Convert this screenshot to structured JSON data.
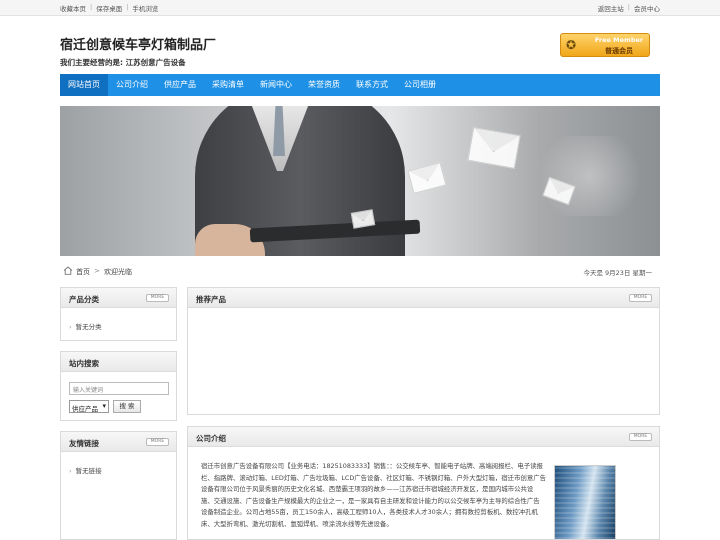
{
  "topbar": {
    "left": [
      "收藏本页",
      "保存桌面",
      "手机浏览"
    ],
    "right": [
      "返回主站",
      "会员中心"
    ],
    "sep": "|"
  },
  "header": {
    "title": "宿迁创意候车亭灯箱制品厂",
    "subtitle": "我们主要经营的是: 江苏创意广告设备"
  },
  "member_badge": {
    "line1": "Free Member",
    "line2": "普通会员"
  },
  "nav": [
    "网站首页",
    "公司介绍",
    "供应产品",
    "采购清单",
    "新闻中心",
    "荣誉资质",
    "联系方式",
    "公司相册"
  ],
  "breadcrumb": {
    "home": "首页",
    "arrow": ">",
    "current": "欢迎光临",
    "date": "今天是  9月23日 星期一"
  },
  "more_label": "MORE",
  "sidebar": {
    "categories": {
      "title": "产品分类",
      "items": [
        "暂无分类"
      ]
    },
    "search": {
      "title": "站内搜索",
      "placeholder": "输入关键词",
      "select_value": "供应产品",
      "button": "搜 索"
    },
    "links": {
      "title": "友情链接",
      "items": [
        "暂无链接"
      ]
    }
  },
  "recommend": {
    "title": "推荐产品"
  },
  "intro": {
    "title": "公司介绍",
    "text": "宿迁市创意广告设备有限公司【业务电话：18251083333】销售：：公交候车亭、智能电子站牌、高端阅报栏、电子读报栏、指路牌、滚动灯箱、LED灯箱、广告垃圾箱、LCD广告设备、社区灯箱、不锈钢灯箱、户外大型灯箱，宿迁市创意广告设备有限公司位于风景秀丽的历史文化名城、西楚霸王项羽的故乡——江苏宿迁市宿城经济开发区，是国内城市公共设施、交通设施、广告设备生产规模最大的企业之一，是一家具有自主研发和设计能力的以公交候车亭为主导的综合性广告设备制造企业。公司占地55亩，员工150余人，高级工程师10人，各类技术人才30余人；拥有数控剪板机、数控冲孔机床、大型折弯机、激光切割机、氩弧焊机、喷涂流水线等先进设备。"
  }
}
